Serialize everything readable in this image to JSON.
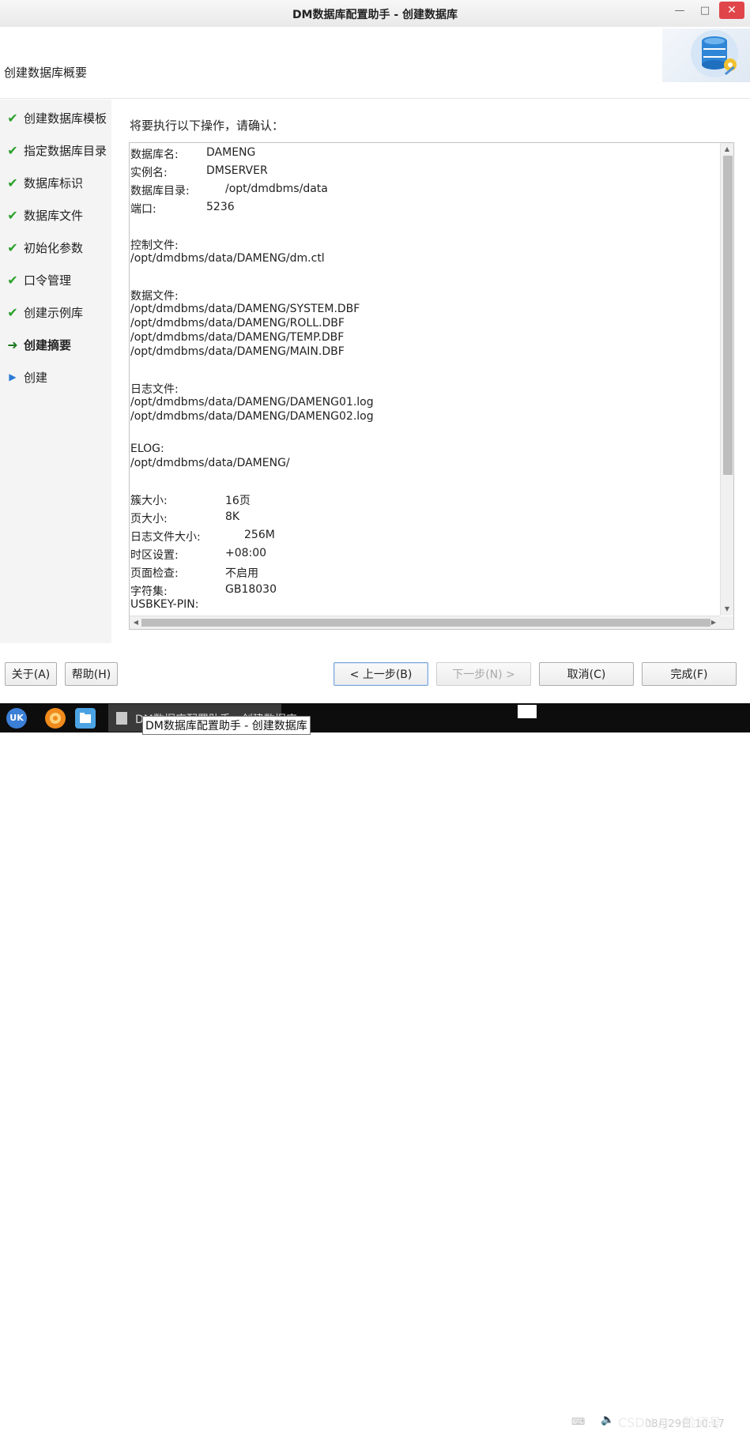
{
  "window": {
    "title": "DM数据库配置助手 - 创建数据库",
    "minimize_glyph": "—",
    "maximize_glyph": "□",
    "close_glyph": "✕"
  },
  "header": {
    "title": "创建数据库概要",
    "logo_icon": "database-gear-icon"
  },
  "sidebar": {
    "steps": [
      {
        "label": "创建数据库模板",
        "status": "done",
        "icon": "check-icon"
      },
      {
        "label": "指定数据库目录",
        "status": "done",
        "icon": "check-icon"
      },
      {
        "label": "数据库标识",
        "status": "done",
        "icon": "check-icon"
      },
      {
        "label": "数据库文件",
        "status": "done",
        "icon": "check-icon"
      },
      {
        "label": "初始化参数",
        "status": "done",
        "icon": "check-icon"
      },
      {
        "label": "口令管理",
        "status": "done",
        "icon": "check-icon"
      },
      {
        "label": "创建示例库",
        "status": "done",
        "icon": "check-icon"
      },
      {
        "label": "创建摘要",
        "status": "current",
        "icon": "arrow-right-icon"
      },
      {
        "label": "创建",
        "status": "pending",
        "icon": "triangle-right-icon"
      }
    ]
  },
  "main": {
    "confirm_label": "将要执行以下操作，请确认：",
    "summary": {
      "db_name_label": "数据库名:",
      "db_name_value": "DAMENG",
      "instance_label": "实例名:",
      "instance_value": "DMSERVER",
      "db_dir_label": "数据库目录:",
      "db_dir_value": "/opt/dmdbms/data",
      "port_label": "端口:",
      "port_value": "5236",
      "control_file_label": "控制文件:",
      "control_file_path": "/opt/dmdbms/data/DAMENG/dm.ctl",
      "data_files_label": "数据文件:",
      "data_files": [
        "/opt/dmdbms/data/DAMENG/SYSTEM.DBF",
        "/opt/dmdbms/data/DAMENG/ROLL.DBF",
        "/opt/dmdbms/data/DAMENG/TEMP.DBF",
        "/opt/dmdbms/data/DAMENG/MAIN.DBF"
      ],
      "log_files_label": "日志文件:",
      "log_files": [
        "/opt/dmdbms/data/DAMENG/DAMENG01.log",
        "/opt/dmdbms/data/DAMENG/DAMENG02.log"
      ],
      "elog_label": "ELOG:",
      "elog_path": "/opt/dmdbms/data/DAMENG/",
      "extent_size_label": "簇大小:",
      "extent_size_value": "16页",
      "page_size_label": "页大小:",
      "page_size_value": "8K",
      "log_size_label": "日志文件大小:",
      "log_size_value": "256M",
      "timezone_label": "时区设置:",
      "timezone_value": "+08:00",
      "page_check_label": "页面检查:",
      "page_check_value": "不启用",
      "charset_label": "字符集:",
      "charset_value": "GB18030",
      "usbkey_label": "USBKEY-PIN:"
    }
  },
  "buttons": {
    "about": "关于(A)",
    "help": "帮助(H)",
    "back": "< 上一步(B)",
    "next": "下一步(N) >",
    "cancel": "取消(C)",
    "finish": "完成(F)"
  },
  "taskbar": {
    "start_icon_label": "UK",
    "task_label": "DM数据库配置助手 - 创建数据库",
    "tooltip": "DM数据库配置助手 - 创建数据库",
    "watermark": "CSDN @一脸问号",
    "clock": "08月29日 10:17"
  }
}
